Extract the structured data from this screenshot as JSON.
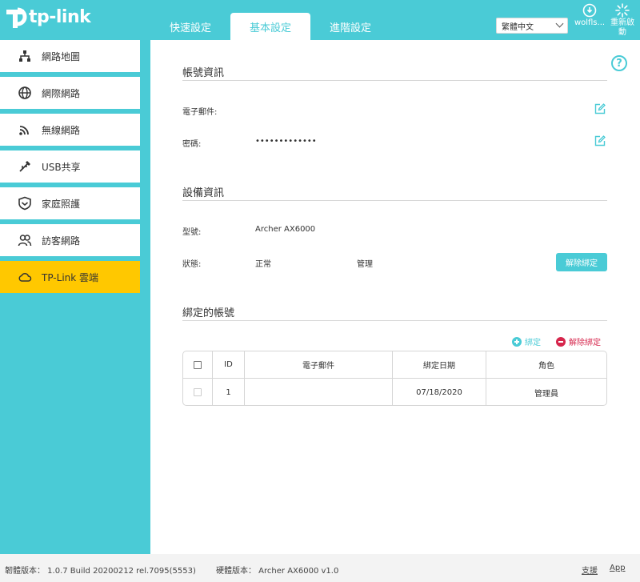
{
  "brand": {
    "name": "tp-link"
  },
  "tabs": [
    {
      "label": "快速設定"
    },
    {
      "label": "基本設定",
      "active": true
    },
    {
      "label": "進階設定"
    }
  ],
  "header": {
    "language": "繁體中文",
    "user_label": "wolfls...",
    "reboot_label": "重新啟動"
  },
  "sidebar": {
    "items": [
      {
        "label": "網路地圖",
        "icon": "network-map-icon"
      },
      {
        "label": "網際網路",
        "icon": "globe-icon"
      },
      {
        "label": "無線網路",
        "icon": "wireless-icon"
      },
      {
        "label": "USB共享",
        "icon": "usb-icon"
      },
      {
        "label": "家庭照護",
        "icon": "shield-icon"
      },
      {
        "label": "訪客網路",
        "icon": "guest-icon"
      },
      {
        "label": "TP-Link 雲端",
        "icon": "cloud-icon",
        "active": true
      }
    ]
  },
  "account": {
    "title": "帳號資訊",
    "email_label": "電子郵件:",
    "email_value": "",
    "password_label": "密碼:",
    "password_value": "•••••••••••••"
  },
  "device": {
    "title": "設備資訊",
    "model_label": "型號:",
    "model_value": "Archer AX6000",
    "status_label": "狀態:",
    "status_value": "正常",
    "status_role": "管理",
    "unbind_button": "解除綁定"
  },
  "bound": {
    "title": "綁定的帳號",
    "add_label": "綁定",
    "remove_label": "解除綁定",
    "columns": [
      "ID",
      "電子郵件",
      "綁定日期",
      "角色"
    ],
    "rows": [
      {
        "id": "1",
        "email": "",
        "date": "07/18/2020",
        "role": "管理員"
      }
    ]
  },
  "footer": {
    "firmware": "韌體版本： 1.0.7 Build 20200212 rel.7095(5553)",
    "hardware": "硬體版本： Archer AX6000 v1.0",
    "support": "支援",
    "app": "App"
  },
  "colors": {
    "accent": "#4acbd6",
    "active_item": "#ffc800",
    "danger": "#d6264c"
  }
}
